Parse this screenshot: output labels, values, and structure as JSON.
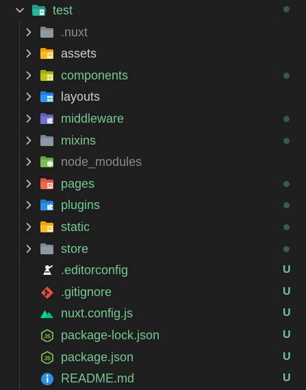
{
  "theme": {
    "background": "#1e1e1e",
    "untracked_green": "#73c991",
    "default_text": "#cccccc",
    "ignored_text": "#8b8b8b",
    "indicator_dot": "#395a43",
    "chevron": "#c5c5c5"
  },
  "root": {
    "label": "test",
    "icon": "folder-open-test-icon",
    "expanded": true,
    "color": "#73c991",
    "has_dot": true
  },
  "items": [
    {
      "label": ".nuxt",
      "kind": "folder",
      "icon": "folder-gray-icon",
      "color": "#8b8b8b",
      "status": "",
      "has_dot": false
    },
    {
      "label": "assets",
      "kind": "folder",
      "icon": "folder-assets-icon",
      "color": "#cccccc",
      "status": "",
      "has_dot": false
    },
    {
      "label": "components",
      "kind": "folder",
      "icon": "folder-components-icon",
      "color": "#73c991",
      "status": "",
      "has_dot": true
    },
    {
      "label": "layouts",
      "kind": "folder",
      "icon": "folder-layouts-icon",
      "color": "#cccccc",
      "status": "",
      "has_dot": false
    },
    {
      "label": "middleware",
      "kind": "folder",
      "icon": "folder-middleware-icon",
      "color": "#73c991",
      "status": "",
      "has_dot": true
    },
    {
      "label": "mixins",
      "kind": "folder",
      "icon": "folder-gray-icon",
      "color": "#73c991",
      "status": "",
      "has_dot": true
    },
    {
      "label": "node_modules",
      "kind": "folder",
      "icon": "folder-node-icon",
      "color": "#8b8b8b",
      "status": "",
      "has_dot": false
    },
    {
      "label": "pages",
      "kind": "folder",
      "icon": "folder-pages-icon",
      "color": "#73c991",
      "status": "",
      "has_dot": true
    },
    {
      "label": "plugins",
      "kind": "folder",
      "icon": "folder-plugins-icon",
      "color": "#73c991",
      "status": "",
      "has_dot": true
    },
    {
      "label": "static",
      "kind": "folder",
      "icon": "folder-static-icon",
      "color": "#73c991",
      "status": "",
      "has_dot": true
    },
    {
      "label": "store",
      "kind": "folder",
      "icon": "folder-gray-icon",
      "color": "#73c991",
      "status": "",
      "has_dot": true
    },
    {
      "label": ".editorconfig",
      "kind": "file",
      "icon": "editorconfig-icon",
      "color": "#73c991",
      "status": "U",
      "has_dot": false
    },
    {
      "label": ".gitignore",
      "kind": "file",
      "icon": "git-icon",
      "color": "#73c991",
      "status": "U",
      "has_dot": false
    },
    {
      "label": "nuxt.config.js",
      "kind": "file",
      "icon": "nuxt-icon",
      "color": "#73c991",
      "status": "U",
      "has_dot": false
    },
    {
      "label": "package-lock.json",
      "kind": "file",
      "icon": "nodejs-icon",
      "color": "#73c991",
      "status": "U",
      "has_dot": false
    },
    {
      "label": "package.json",
      "kind": "file",
      "icon": "nodejs-icon",
      "color": "#73c991",
      "status": "U",
      "has_dot": false
    },
    {
      "label": "README.md",
      "kind": "file",
      "icon": "info-icon",
      "color": "#73c991",
      "status": "U",
      "has_dot": false
    }
  ]
}
